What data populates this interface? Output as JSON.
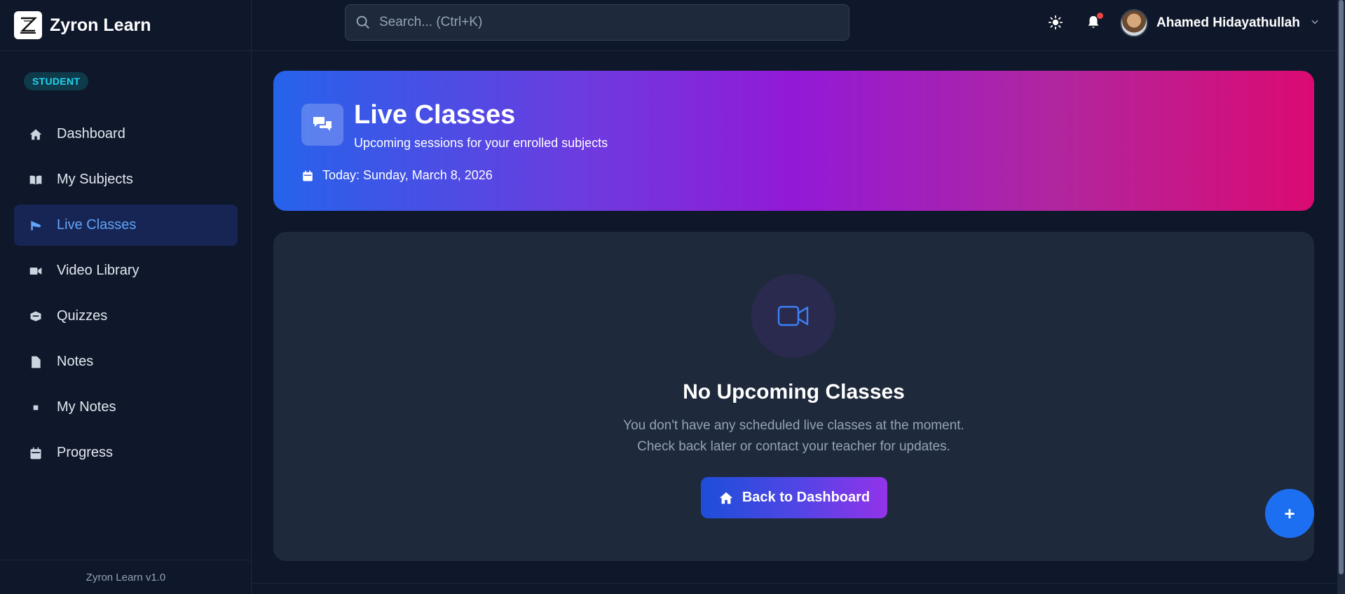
{
  "brand": {
    "name": "Zyron Learn",
    "logo_icon": "zyron-logo"
  },
  "sidebar": {
    "role_badge": "STUDENT",
    "items": [
      {
        "label": "Dashboard",
        "icon": "home-icon",
        "active": false
      },
      {
        "label": "My Subjects",
        "icon": "book-icon",
        "active": false
      },
      {
        "label": "Live Classes",
        "icon": "broadcast-icon",
        "active": true
      },
      {
        "label": "Video Library",
        "icon": "video-icon",
        "active": false
      },
      {
        "label": "Quizzes",
        "icon": "quiz-icon",
        "active": false
      },
      {
        "label": "Notes",
        "icon": "file-icon",
        "active": false
      },
      {
        "label": "My Notes",
        "icon": "note-icon",
        "active": false
      },
      {
        "label": "Progress",
        "icon": "calendar-icon",
        "active": false
      }
    ],
    "footer": "Zyron Learn v1.0"
  },
  "header": {
    "search_placeholder": "Search... (Ctrl+K)",
    "user_name": "Ahamed Hidayathullah",
    "has_notification": true
  },
  "hero": {
    "title": "Live Classes",
    "subtitle": "Upcoming sessions for your enrolled subjects",
    "date": "Today: Sunday, March 8, 2026"
  },
  "empty_state": {
    "title": "No Upcoming Classes",
    "line1": "You don't have any scheduled live classes at the moment.",
    "line2": "Check back later or contact your teacher for updates.",
    "button_label": "Back to Dashboard"
  },
  "fab": {
    "label": "+"
  },
  "colors": {
    "background": "#0f172a",
    "card": "#1e293b",
    "accent": "#60a5fa",
    "badge_text": "#22d3ee",
    "hero_start": "#2563eb",
    "hero_end": "#db0a72",
    "fab": "#1d6ff2"
  }
}
